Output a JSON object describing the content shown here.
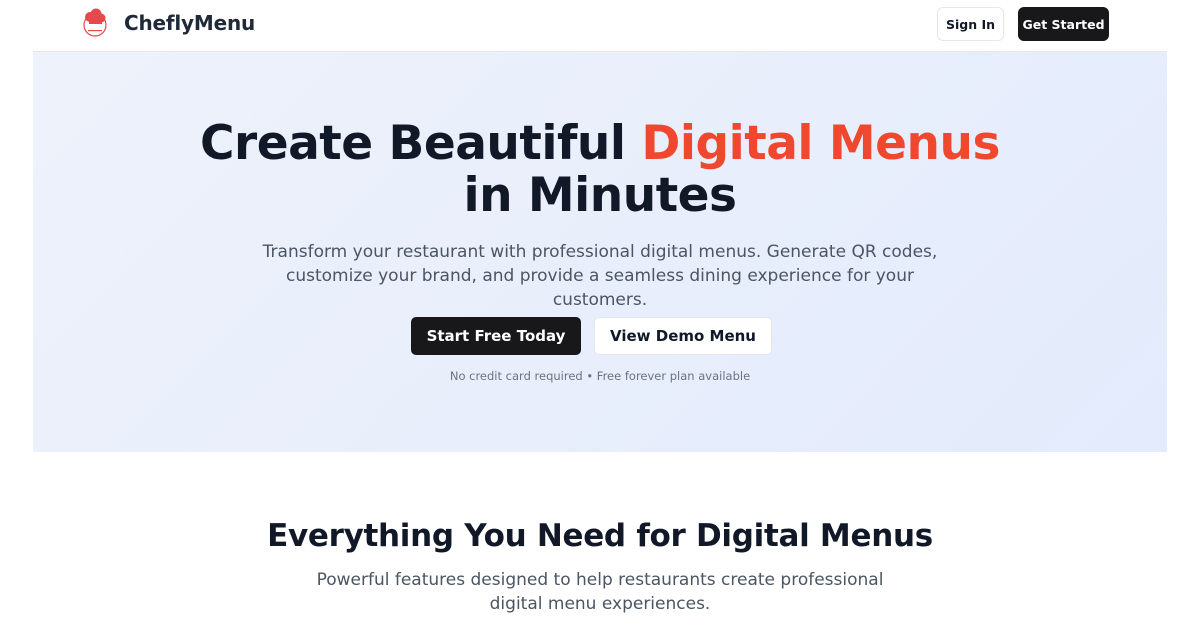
{
  "header": {
    "brand": "CheflyMenu",
    "logo_icon": "chef-hat-logo-icon",
    "signin_label": "Sign In",
    "get_started_label": "Get Started"
  },
  "hero": {
    "title_part1": "Create Beautiful ",
    "title_accent": "Digital Menus",
    "title_part2": "in Minutes",
    "subtitle": "Transform your restaurant with professional digital menus. Generate QR codes, customize your brand, and provide a seamless dining experience for your customers.",
    "primary_cta": "Start Free Today",
    "secondary_cta": "View Demo Menu",
    "note": "No credit card required • Free forever plan available"
  },
  "features": {
    "title": "Everything You Need for Digital Menus",
    "subtitle": "Powerful features designed to help restaurants create professional digital menu experiences."
  },
  "colors": {
    "accent": "#f0482f",
    "dark_button": "#18181b",
    "hero_bg": "#e8eefb"
  }
}
